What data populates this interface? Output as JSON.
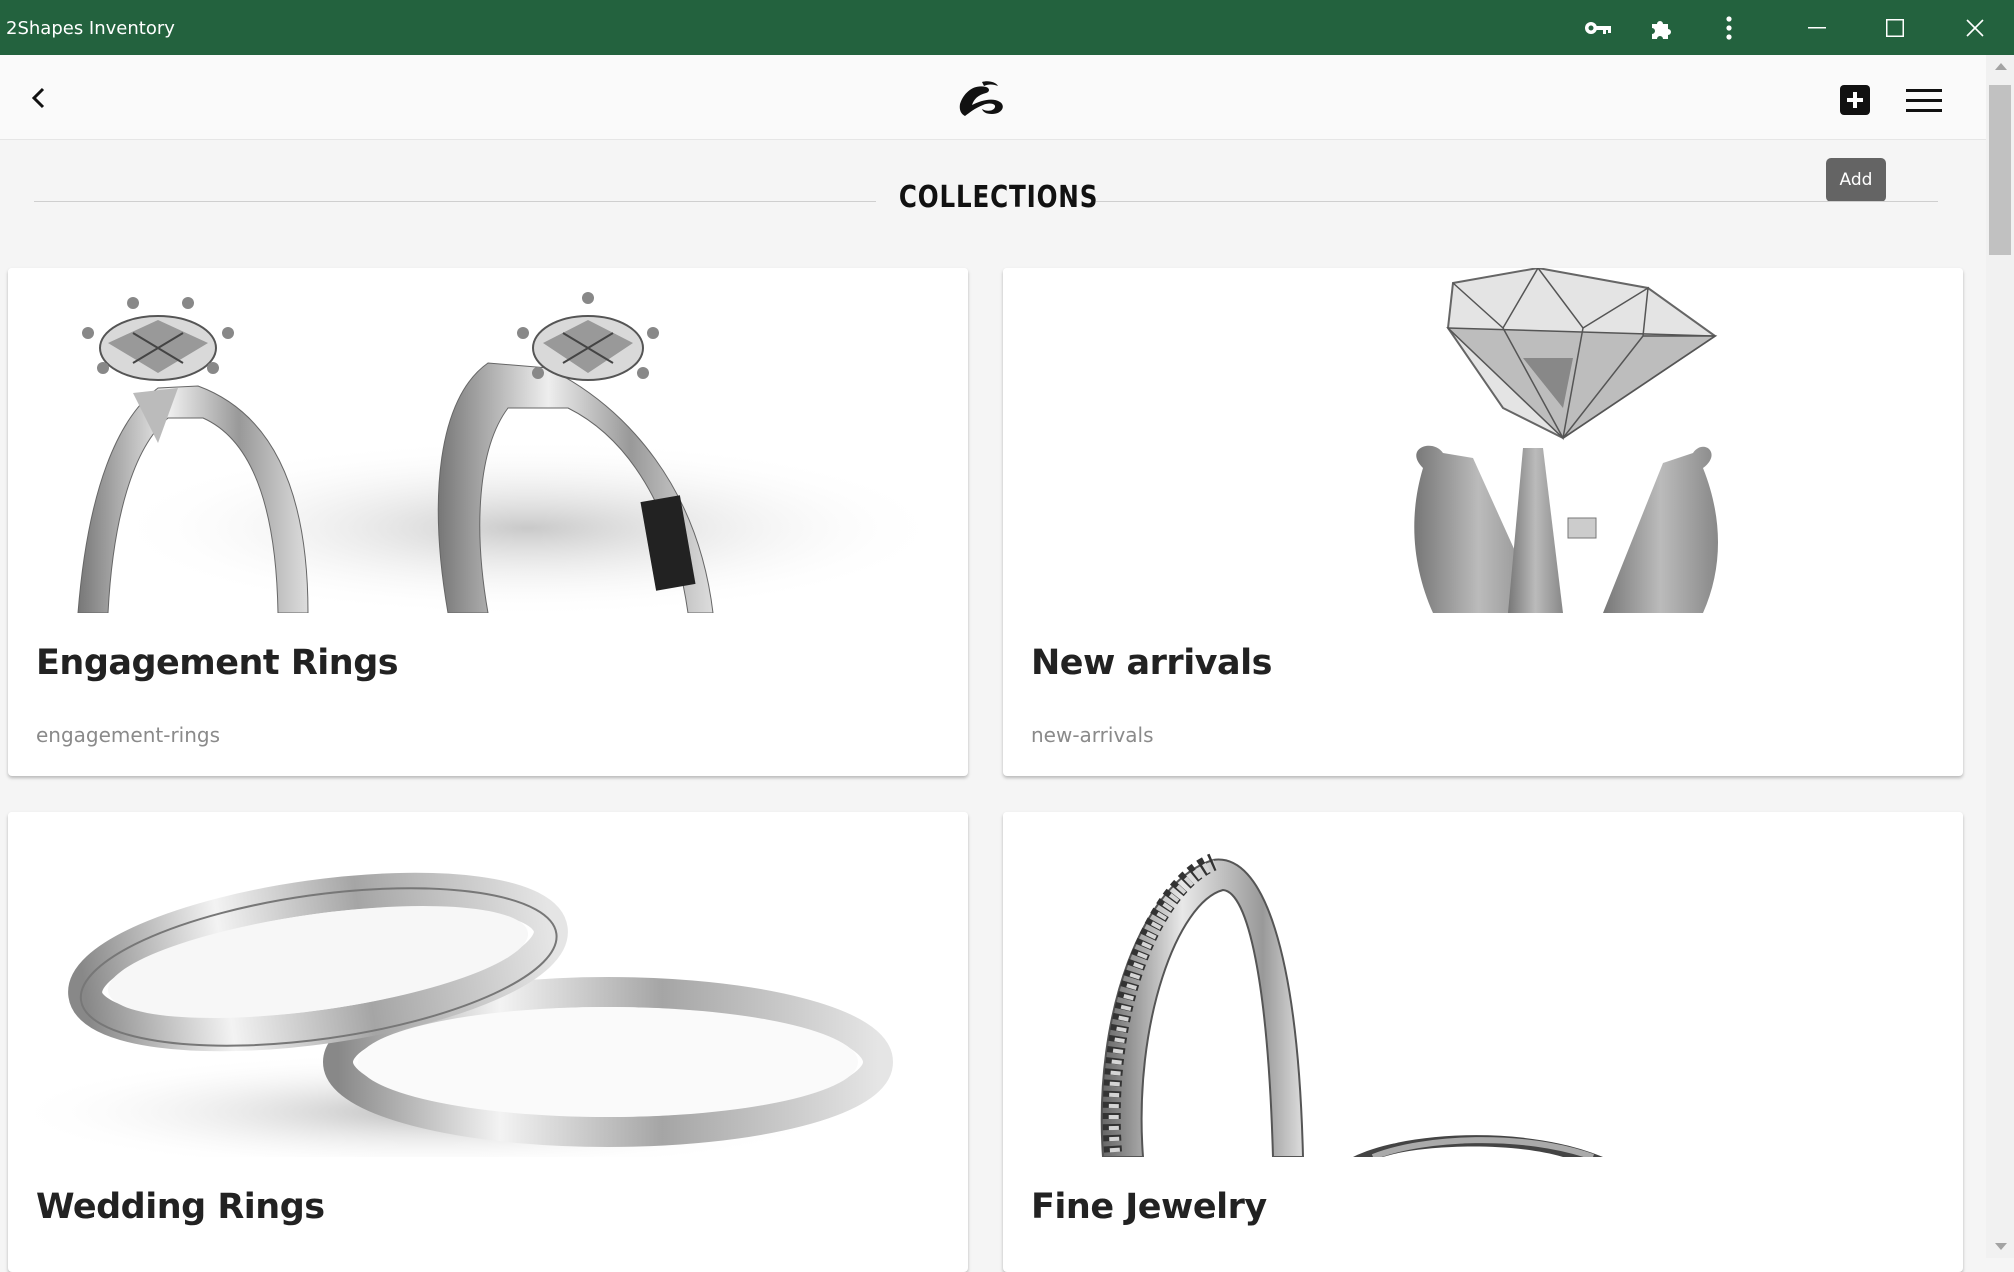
{
  "window": {
    "title": "2Shapes Inventory",
    "title_bar_color": "#23623e",
    "icons": [
      "key-icon",
      "puzzle-icon",
      "more-vertical-icon",
      "minimize-icon",
      "maximize-icon",
      "close-icon"
    ]
  },
  "header": {
    "back_icon": "chevron-left-icon",
    "logo": "2shapes-logo",
    "add_icon": "plus-square-icon",
    "menu_icon": "hamburger-icon",
    "tooltip": "Add"
  },
  "section": {
    "title": "COLLECTIONS"
  },
  "collections": [
    {
      "name": "Engagement Rings",
      "slug": "engagement-rings",
      "image": "engagement-rings-image"
    },
    {
      "name": "New arrivals",
      "slug": "new-arrivals",
      "image": "loose-diamond-image"
    },
    {
      "name": "Wedding Rings",
      "slug": "",
      "image": "wedding-bands-image"
    },
    {
      "name": "Fine Jewelry",
      "slug": "",
      "image": "diamond-band-image"
    }
  ]
}
